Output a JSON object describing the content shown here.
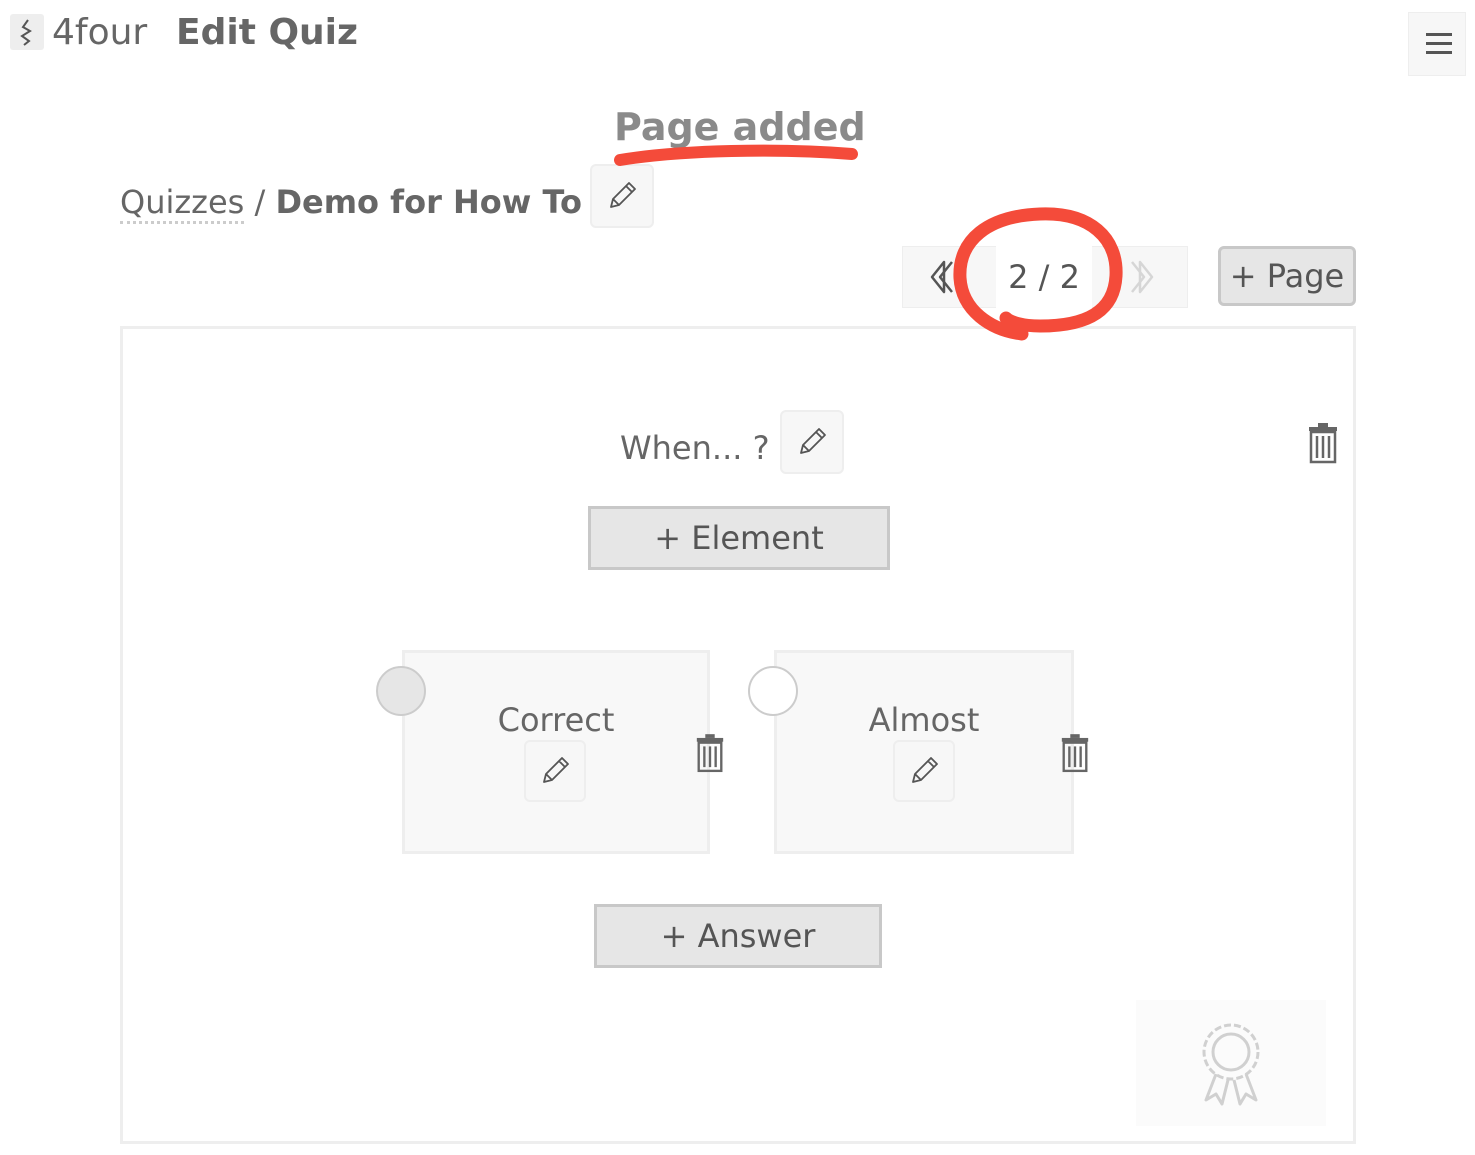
{
  "header": {
    "app_name": "4four",
    "page_title": "Edit Quiz",
    "logo_icon": "app-logo-icon",
    "menu_icon": "hamburger-menu-icon"
  },
  "flash": {
    "message": "Page added"
  },
  "breadcrumb": {
    "link": "Quizzes",
    "separator": " / ",
    "current": "Demo for How To"
  },
  "pager": {
    "current_label": "2 / 2",
    "prev_icon": "chevron-left-icon",
    "next_icon": "chevron-right-icon",
    "add_page_label": "+ Page"
  },
  "question": {
    "text": "When... ?",
    "add_element_label": "+ Element",
    "add_answer_label": "+ Answer"
  },
  "answers": [
    {
      "label": "Correct",
      "selected": true
    },
    {
      "label": "Almost",
      "selected": false
    }
  ],
  "annotations": {
    "color": "#f44b3a"
  },
  "colors": {
    "text": "#666666",
    "button_bg": "#e6e6e6",
    "button_border": "#c8c8c8",
    "panel_bg": "#f8f8f8"
  }
}
